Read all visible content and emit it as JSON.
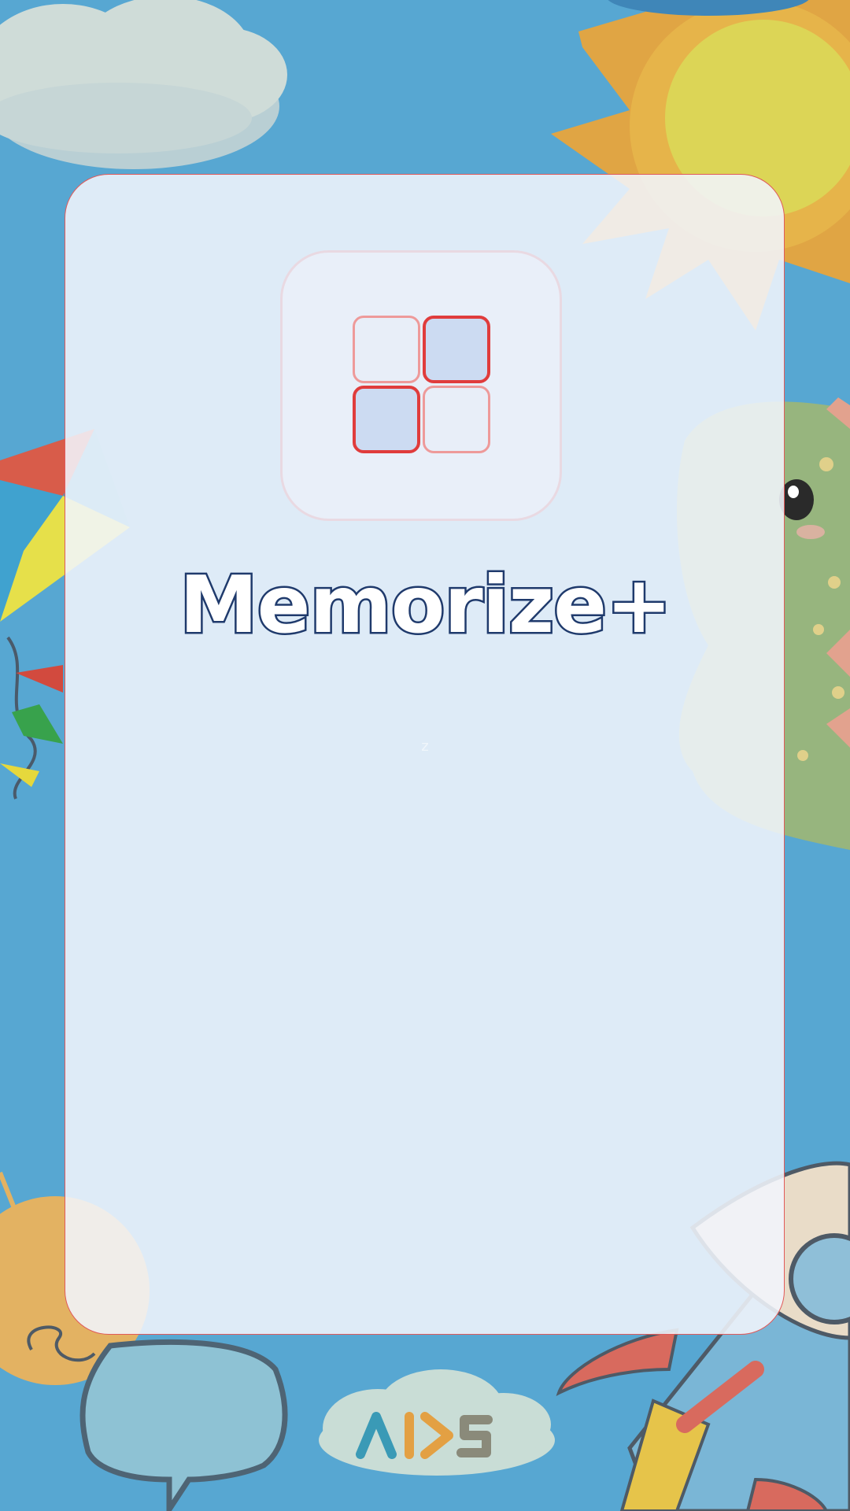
{
  "app": {
    "title": "Memorize+",
    "hint_glyph": "z",
    "brand_text": "AIDS"
  },
  "logo": {
    "tiles": [
      "light",
      "dark",
      "dark",
      "light"
    ]
  },
  "decorations": [
    "cloud",
    "sun",
    "kite",
    "dinosaur",
    "lightbulb",
    "speech-bubble",
    "rocket",
    "brand-cloud"
  ],
  "colors": {
    "background": "#57a7d2",
    "card_border": "#e05a5a",
    "tile_dark_border": "#e03c3c",
    "tile_light_border": "#ee9a9a",
    "title_outline": "#1f3a6c"
  }
}
